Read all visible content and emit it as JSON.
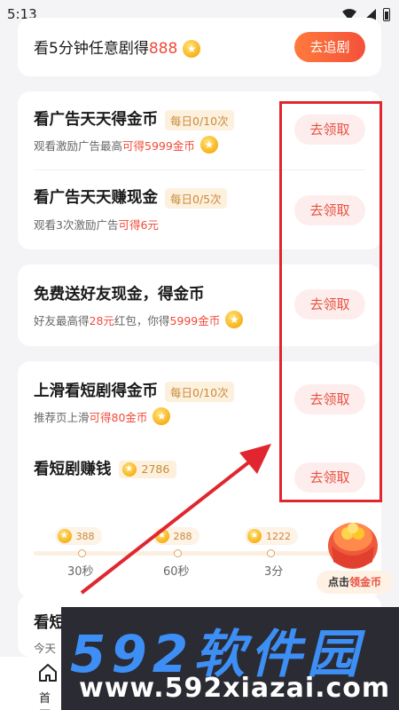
{
  "status_bar": {
    "time": "5:13"
  },
  "top_card": {
    "text_prefix": "看5分钟任意剧得",
    "text_amount": "888",
    "button": "去追剧"
  },
  "card_ads": {
    "row1": {
      "title": "看广告天天得金币",
      "tag": "每日0/10次",
      "sub_prefix": "观看激励广告最高",
      "sub_hl": "可得5999金币",
      "button": "去领取"
    },
    "row2": {
      "title": "看广告天天赚现金",
      "tag": "每日0/5次",
      "sub_prefix": "观看3次激励广告",
      "sub_hl": "可得6元",
      "button": "去领取"
    }
  },
  "card_invite": {
    "title": "免费送好友现金，得金币",
    "sub_1": "好友最高得",
    "sub_hl1": "28元",
    "sub_2": "红包，你得",
    "sub_hl2": "5999金币",
    "button": "去领取"
  },
  "card_drama": {
    "row1": {
      "title": "上滑看短剧得金币",
      "tag": "每日0/10次",
      "sub_prefix": "推荐页上滑",
      "sub_hl": "可得80金币",
      "button": "去领取"
    },
    "row2": {
      "title": "看短剧赚钱",
      "coins": "2786",
      "button": "去领取"
    },
    "milestones": [
      {
        "coins": "388",
        "label": "30秒"
      },
      {
        "coins": "288",
        "label": "60秒"
      },
      {
        "coins": "1222",
        "label": "3分"
      }
    ],
    "chest_label_prefix": "点击",
    "chest_label_hl": "领金币"
  },
  "partial_card": {
    "title": "看短",
    "sub": "今天"
  },
  "watermark": {
    "big": "592软件园",
    "url": "www.592xiazai.com"
  },
  "bottom_nav": {
    "home": "首页"
  },
  "colors": {
    "accent": "#f4513a",
    "highlight": "#f04b3a",
    "annotation": "#e0262f"
  }
}
